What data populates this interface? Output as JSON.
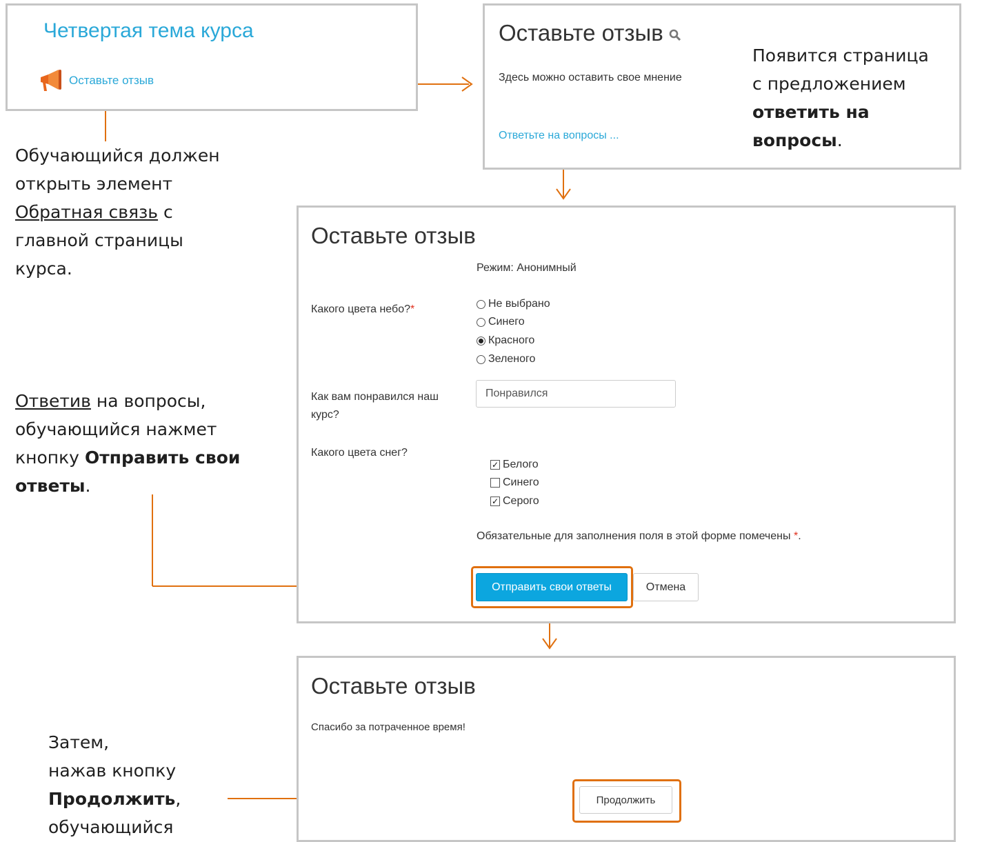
{
  "panel1": {
    "topic_title": "Четвертая тема курса",
    "feedback_link": "Оставьте отзыв",
    "megaphone_icon": "megaphone-icon"
  },
  "panel2": {
    "title": "Оставьте отзыв",
    "search_icon": "search-icon",
    "description": "Здесь можно оставить свое мнение",
    "answer_link": "Ответьте на вопросы ..."
  },
  "panel3": {
    "title": "Оставьте отзыв",
    "mode": "Режим: Анонимный",
    "q1": {
      "label": "Какого цвета небо?",
      "required_mark": "*",
      "options": [
        "Не выбрано",
        "Синего",
        "Красного",
        "Зеленого"
      ],
      "selected": "Красного"
    },
    "q2": {
      "label_line1": "Как вам понравился наш",
      "label_line2": "курс?",
      "value": "Понравился"
    },
    "q3": {
      "label": "Какого цвета снег?",
      "options": [
        {
          "label": "Белого",
          "checked": true
        },
        {
          "label": "Синего",
          "checked": false
        },
        {
          "label": "Серого",
          "checked": true
        }
      ]
    },
    "required_note": "Обязательные для заполнения поля в этой форме помечены",
    "required_note_mark": "*",
    "required_note_end": ".",
    "submit_button": "Отправить свои ответы",
    "cancel_button": "Отмена"
  },
  "panel4": {
    "title": "Оставьте отзыв",
    "thanks": "Спасибо за потраченное время!",
    "continue_button": "Продолжить"
  },
  "annotations": {
    "a1_line1": "Появится страница",
    "a1_line2": "с предложением",
    "a1_bold": "ответить на вопросы",
    "a1_end": ".",
    "a2_line1": "Обучающийся должен",
    "a2_line2": "открыть элемент",
    "a2_underline": "Обратная связь",
    "a2_after": " с",
    "a2_line4": "главной страницы",
    "a2_line5": "курса.",
    "a3_underline": "Ответив",
    "a3_after": " на вопросы,",
    "a3_line2": "обучающийся нажмет",
    "a3_line3": "кнопку ",
    "a3_bold": "Отправить свои",
    "a3_bold2": "ответы",
    "a3_end": ".",
    "a4_line1": "Затем,",
    "a4_line2": "нажав кнопку",
    "a4_bold": "Продолжить",
    "a4_comma": ",",
    "a4_line4": "обучающийся"
  },
  "colors": {
    "accent_orange": "#e0700f",
    "link_blue": "#2aa8d8",
    "button_blue": "#0ca6df",
    "panel_border": "#c6c6c6",
    "required_red": "#e0301e"
  }
}
